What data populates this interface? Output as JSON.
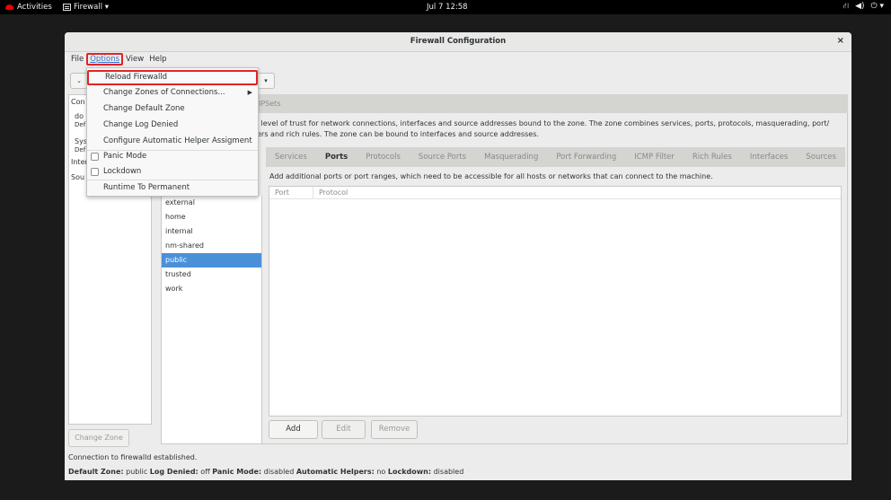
{
  "topbar": {
    "activities": "Activities",
    "app_menu": "Firewall ▾",
    "clock": "Jul 7  12:58",
    "network_icon": "network-icon",
    "volume_icon": "volume-icon",
    "power_icon": "power-icon"
  },
  "window": {
    "title": "Firewall Configuration",
    "close": "×"
  },
  "menubar": {
    "items": [
      "File",
      "Options",
      "View",
      "Help"
    ]
  },
  "options_menu": {
    "items": [
      "Reload Firewalld",
      "Change Zones of Connections...",
      "Change Default Zone",
      "Change Log Denied",
      "Configure Automatic Helper Assigment",
      "Panic Mode",
      "Lockdown",
      "Runtime To Permanent"
    ]
  },
  "left_panel": {
    "lines": [
      "Con",
      "do",
      "Def",
      "Sys",
      "Def",
      "Inter",
      "Sou"
    ],
    "change_zone": "Change Zone"
  },
  "main": {
    "ipsets": "IPSets",
    "desc_line1": "e level of trust for network connections, interfaces and source addresses bound to the zone. The zone combines services, ports, protocols, masquerading, port/",
    "desc_line2": "ters and rich rules. The zone can be bound to interfaces and source addresses.",
    "zones": [
      "external",
      "home",
      "internal",
      "nm-shared",
      "public",
      "trusted",
      "work"
    ],
    "selected_zone": "public",
    "tabs": [
      "Services",
      "Ports",
      "Protocols",
      "Source Ports",
      "Masquerading",
      "Port Forwarding",
      "ICMP Filter",
      "Rich Rules",
      "Interfaces",
      "Sources"
    ],
    "selected_tab": "Ports",
    "ports_desc": "Add additional ports or port ranges, which need to be accessible for all hosts or networks that can connect to the machine.",
    "columns": [
      "Port",
      "Protocol"
    ],
    "add": "Add",
    "edit": "Edit",
    "remove": "Remove"
  },
  "status": {
    "connection": "Connection to firewalld established.",
    "default_zone_label": "Default Zone:",
    "default_zone": "public",
    "log_denied_label": "Log Denied:",
    "log_denied": "off",
    "panic_label": "Panic Mode:",
    "panic": "disabled",
    "helpers_label": "Automatic Helpers:",
    "helpers": "no",
    "lockdown_label": "Lockdown:",
    "lockdown": "disabled"
  }
}
